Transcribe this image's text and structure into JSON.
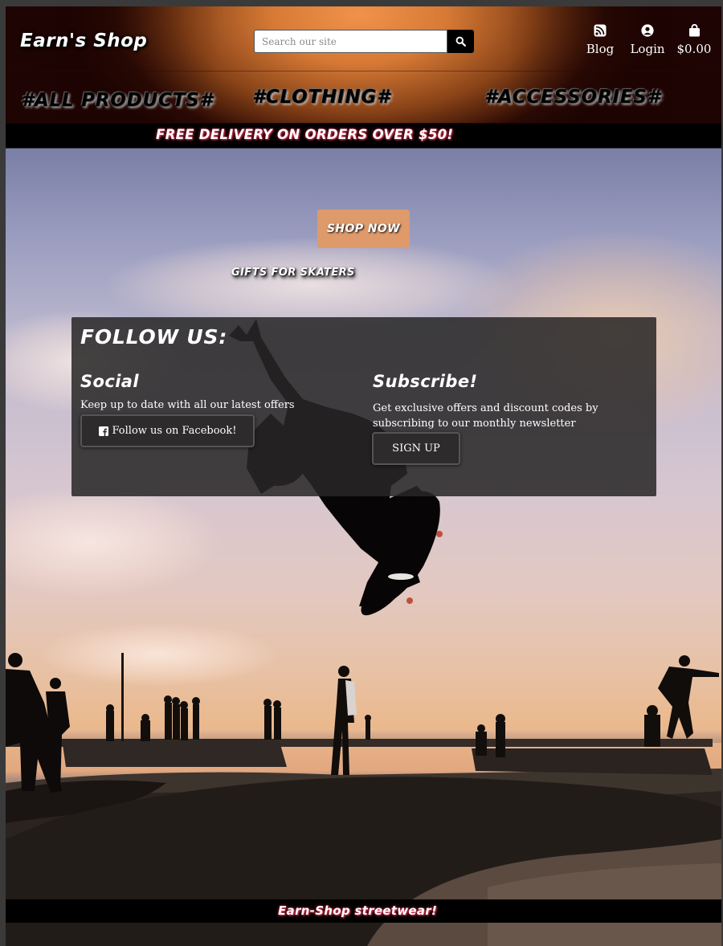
{
  "header": {
    "logo": "Earn's Shop",
    "search": {
      "placeholder": "Search our site",
      "value": ""
    },
    "links": {
      "blog": "Blog",
      "login": "Login",
      "bag_total": "$0.00"
    },
    "nav": {
      "all": "#ALL PRODUCTS#",
      "clothing": "#CLOTHING#",
      "accessories": "#ACCESSORIES#"
    }
  },
  "banner": {
    "text": "FREE DELIVERY ON ORDERS OVER $50!"
  },
  "hero": {
    "shop_now": "SHOP NOW",
    "gifts": "GIFTS FOR SKATERS"
  },
  "follow": {
    "title": "FOLLOW US:",
    "social": {
      "title": "Social",
      "text": "Keep up to date with all our latest offers",
      "button": "Follow us on Facebook!"
    },
    "subscribe": {
      "title": "Subscribe!",
      "text": "Get exclusive offers and discount codes by subscribing to our monthly newsletter",
      "button": "SIGN UP"
    }
  },
  "footer": {
    "text": "Earn-Shop streetwear!"
  },
  "colors": {
    "accent": "#de9a6a",
    "header_glow": "#f0924a",
    "panel": "#282626",
    "banner": "#000000",
    "text_glow": "#e63c5a"
  },
  "icons": {
    "blog": "rss-icon",
    "login": "user-circle-icon",
    "bag": "shopping-bag-icon",
    "search": "search-icon",
    "facebook": "facebook-square-icon"
  }
}
